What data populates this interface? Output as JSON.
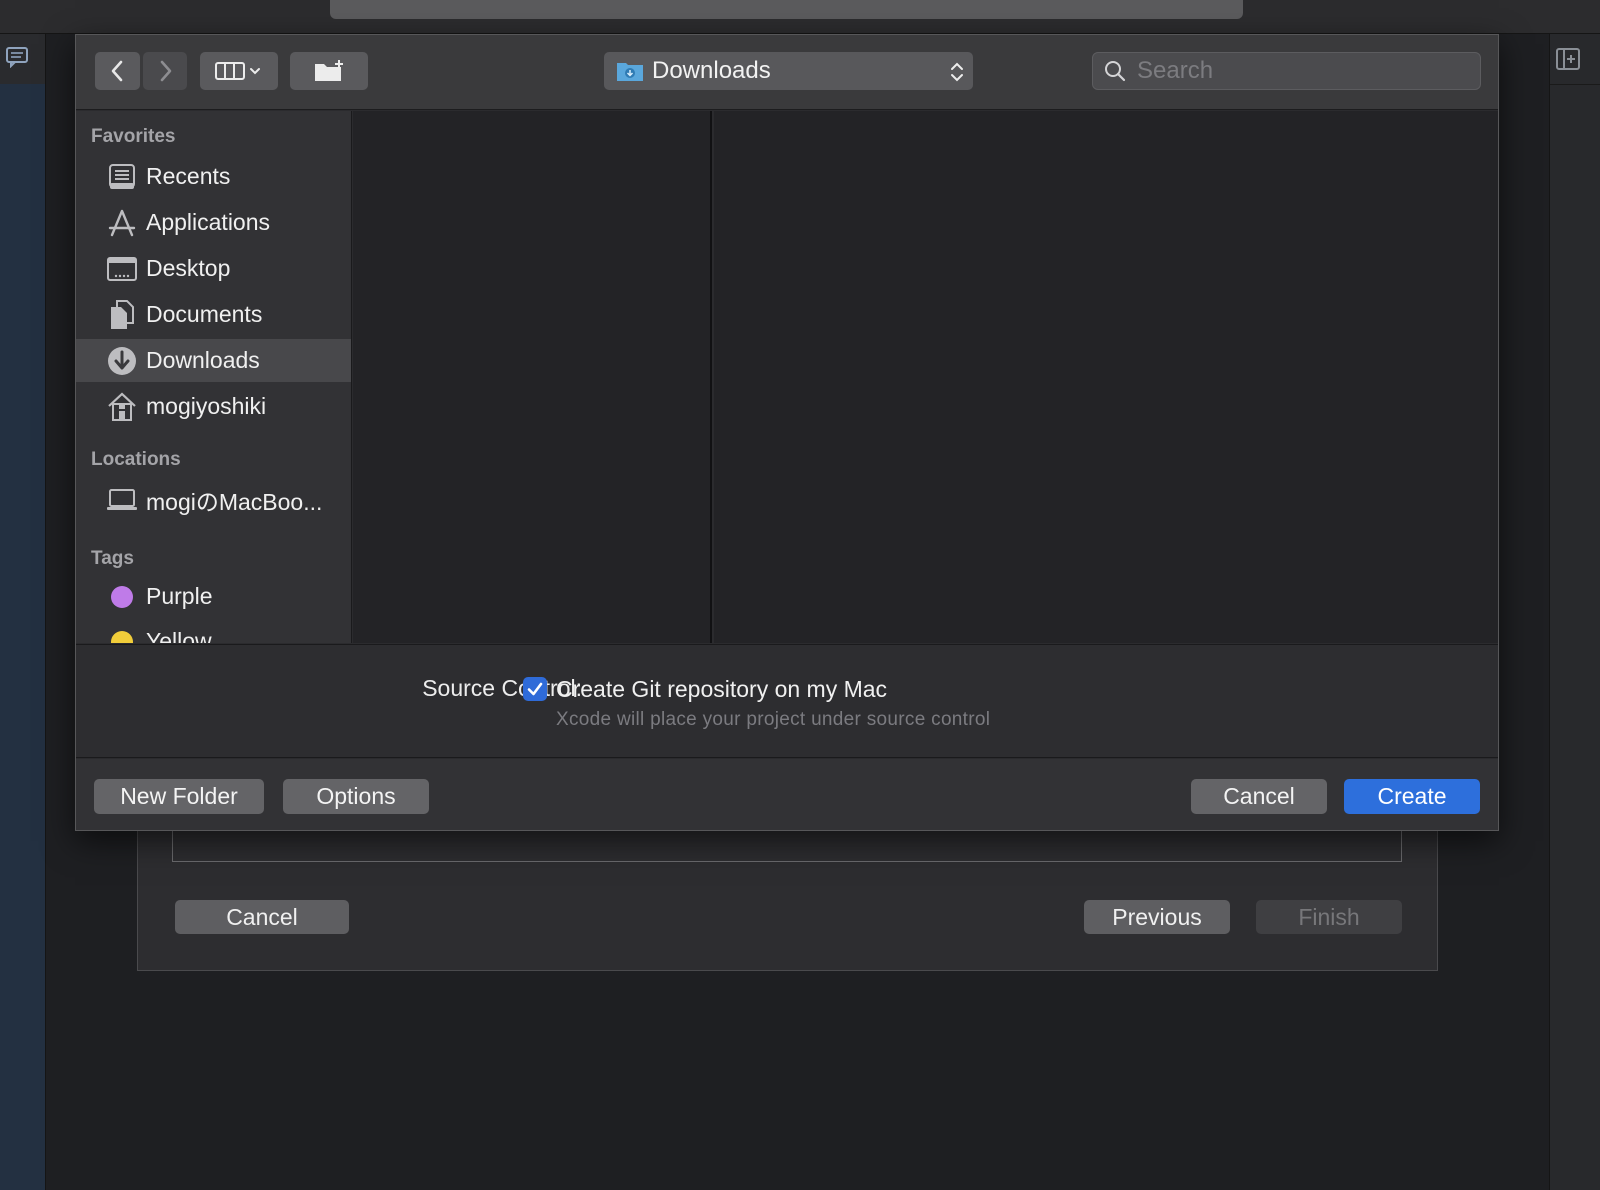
{
  "toolbar": {
    "location": "Downloads",
    "search_placeholder": "Search"
  },
  "sidebar": {
    "sections": [
      {
        "header": "Favorites"
      },
      {
        "header": "Locations"
      },
      {
        "header": "Tags"
      }
    ],
    "favorites": [
      {
        "label": "Recents",
        "icon": "recents-icon"
      },
      {
        "label": "Applications",
        "icon": "applications-icon"
      },
      {
        "label": "Desktop",
        "icon": "desktop-icon"
      },
      {
        "label": "Documents",
        "icon": "documents-icon"
      },
      {
        "label": "Downloads",
        "icon": "downloads-icon",
        "selected": true
      },
      {
        "label": "mogiyoshiki",
        "icon": "home-icon"
      }
    ],
    "locations": [
      {
        "label": "mogiのMacBoo...",
        "icon": "laptop-icon"
      }
    ],
    "tags": [
      {
        "label": "Purple",
        "color": "#bf7be8"
      },
      {
        "label": "Yellow",
        "color": "#f1cd3a"
      }
    ]
  },
  "accessory": {
    "source_control_label": "Source Control:",
    "checkbox_label": "Create Git repository on my Mac",
    "checkbox_checked": true,
    "note": "Xcode will place your project under source control"
  },
  "dialog_buttons": {
    "new_folder": "New Folder",
    "options": "Options",
    "cancel": "Cancel",
    "create": "Create"
  },
  "wizard_buttons": {
    "cancel": "Cancel",
    "previous": "Previous",
    "finish": "Finish"
  },
  "colors": {
    "accent": "#2d6fdc",
    "purple_tag": "#bf7be8",
    "yellow_tag": "#f1cd3a"
  }
}
